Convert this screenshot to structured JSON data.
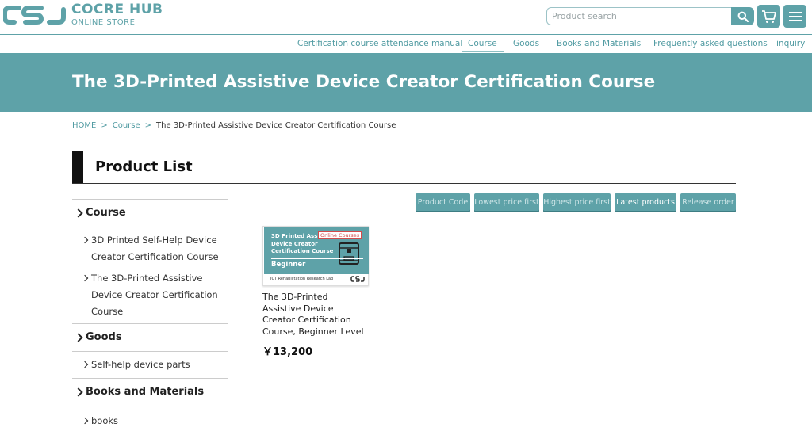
{
  "header": {
    "logo_title": "COCRE HUB",
    "logo_sub": "ONLINE STORE",
    "search_placeholder": "Product search",
    "brand_color": "#5ea2a8"
  },
  "nav": {
    "items": [
      {
        "label": "Certification course attendance manual"
      },
      {
        "label": "Course",
        "active": true
      },
      {
        "label": "Goods"
      },
      {
        "label": "Books and Materials"
      },
      {
        "label": "Frequently asked questions"
      },
      {
        "label": "inquiry"
      }
    ]
  },
  "banner": {
    "title": "The 3D-Printed Assistive Device Creator Certification Course"
  },
  "breadcrumb": {
    "home": "HOME",
    "sep": ">",
    "parent": "Course",
    "current": "The 3D-Printed Assistive Device Creator Certification Course"
  },
  "section": {
    "title": "Product List"
  },
  "sidebar": {
    "categories": [
      {
        "label": "Course",
        "subs": [
          "3D Printed Self-Help Device Creator Certification Course",
          "The 3D-Printed Assistive Device Creator Certification Course"
        ]
      },
      {
        "label": "Goods",
        "subs": [
          "Self-help device parts"
        ]
      },
      {
        "label": "Books and Materials",
        "subs": [
          "books"
        ]
      }
    ]
  },
  "sort": {
    "buttons": [
      {
        "label": "Product Code"
      },
      {
        "label": "Lowest price first"
      },
      {
        "label": "Highest price first"
      },
      {
        "label": "Latest products",
        "active": true
      },
      {
        "label": "Release order"
      }
    ]
  },
  "products": [
    {
      "thumb_title": "3D Printed Assistive Device Creator Certification Course",
      "thumb_badge": "Online Courses",
      "thumb_level": "Beginner",
      "thumb_lab": "ICT Rehabilitation Research Lab",
      "name": "The 3D-Printed Assistive Device Creator Certification Course, Beginner Level",
      "price": "￥13,200"
    }
  ]
}
